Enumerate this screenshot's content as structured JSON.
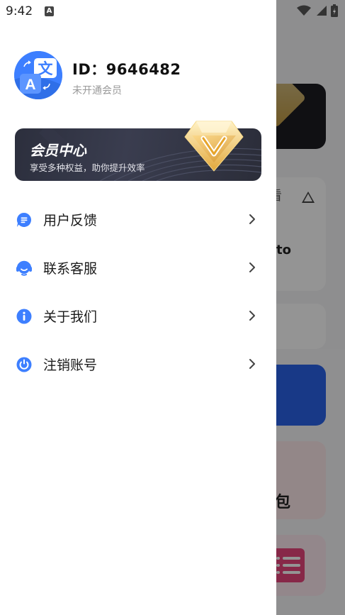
{
  "status_bar": {
    "time": "9:42",
    "notification_icon": "A"
  },
  "profile": {
    "id_text": "ID：9646482",
    "member_status": "未开通会员",
    "avatar_icon": "translate-icon"
  },
  "vip_card": {
    "title": "会员中心",
    "subtitle": "享受多种权益，助你提升效率",
    "badge_icon": "vip-diamond-icon"
  },
  "menu": {
    "items": [
      {
        "label": "用户反馈",
        "icon": "feedback-icon"
      },
      {
        "label": "联系客服",
        "icon": "customer-service-icon"
      },
      {
        "label": "关于我们",
        "icon": "info-icon"
      },
      {
        "label": "注销账号",
        "icon": "power-icon"
      }
    ]
  },
  "background": {
    "fragment_header": "看",
    "fragment_text": "to",
    "fragment_bao": "包"
  },
  "colors": {
    "accent": "#3d7fff",
    "vip_card": "#2c2f3d",
    "vip_gold": "#f2c45a"
  }
}
